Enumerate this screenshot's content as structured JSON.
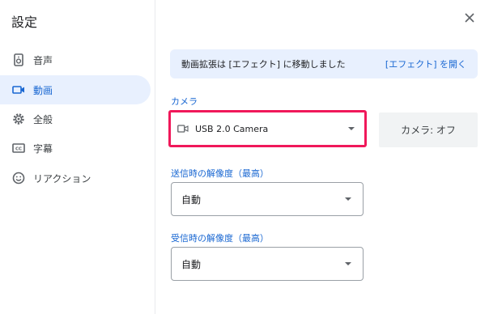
{
  "sidebar": {
    "title": "設定",
    "items": [
      {
        "label": "音声",
        "icon": "speaker-icon"
      },
      {
        "label": "動画",
        "icon": "video-camera-icon"
      },
      {
        "label": "全般",
        "icon": "gear-icon"
      },
      {
        "label": "字幕",
        "icon": "closed-caption-icon"
      },
      {
        "label": "リアクション",
        "icon": "smiley-icon"
      }
    ],
    "active_index": 1
  },
  "banner": {
    "text": "動画拡張は [エフェクト] に移動しました",
    "link": "[エフェクト] を開く"
  },
  "camera": {
    "label": "カメラ",
    "selected": "USB 2.0 Camera",
    "toggle_label": "カメラ: オフ"
  },
  "send_resolution": {
    "label": "送信時の解像度（最高）",
    "selected": "自動"
  },
  "receive_resolution": {
    "label": "受信時の解像度（最高）",
    "selected": "自動"
  },
  "colors": {
    "accent": "#1967d2",
    "active_bg": "#e8f0fe",
    "highlight": "#f0185a"
  }
}
